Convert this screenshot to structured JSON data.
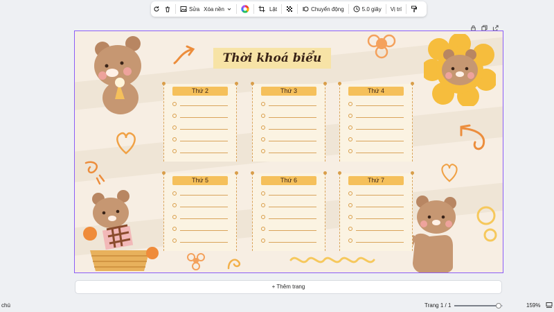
{
  "toolbar": {
    "icons": [
      "rotate-icon",
      "trash-icon",
      "image-icon",
      "chevron-down-icon",
      "color-wheel-icon",
      "crop-icon",
      "flip-icon",
      "transparency-icon",
      "animate-icon",
      "clock-icon",
      "paint-roller-icon"
    ],
    "edit_label": "Sửa",
    "remove_bg_label": "Xóa nền",
    "flip_label": "Lật",
    "animate_label": "Chuyển động",
    "duration_label": "5.0 giây",
    "position_label": "Vị trí"
  },
  "page_actions": [
    "lock-icon",
    "duplicate-icon",
    "share-icon"
  ],
  "canvas": {
    "title": "Thời khoá biểu",
    "days": [
      "Thứ 2",
      "Thứ 3",
      "Thứ 4",
      "Thứ 5",
      "Thứ 6",
      "Thứ 7"
    ]
  },
  "add_page_label": "+ Thêm trang",
  "status": {
    "left_text": "chú",
    "page_indicator": "Trang 1 / 1",
    "zoom_level": "159%",
    "zoom_fraction": 0.92
  },
  "colors": {
    "selection_border": "#8b5cf6",
    "card_tab": "#f5c05b",
    "canvas_bg": "#f7eee3"
  }
}
